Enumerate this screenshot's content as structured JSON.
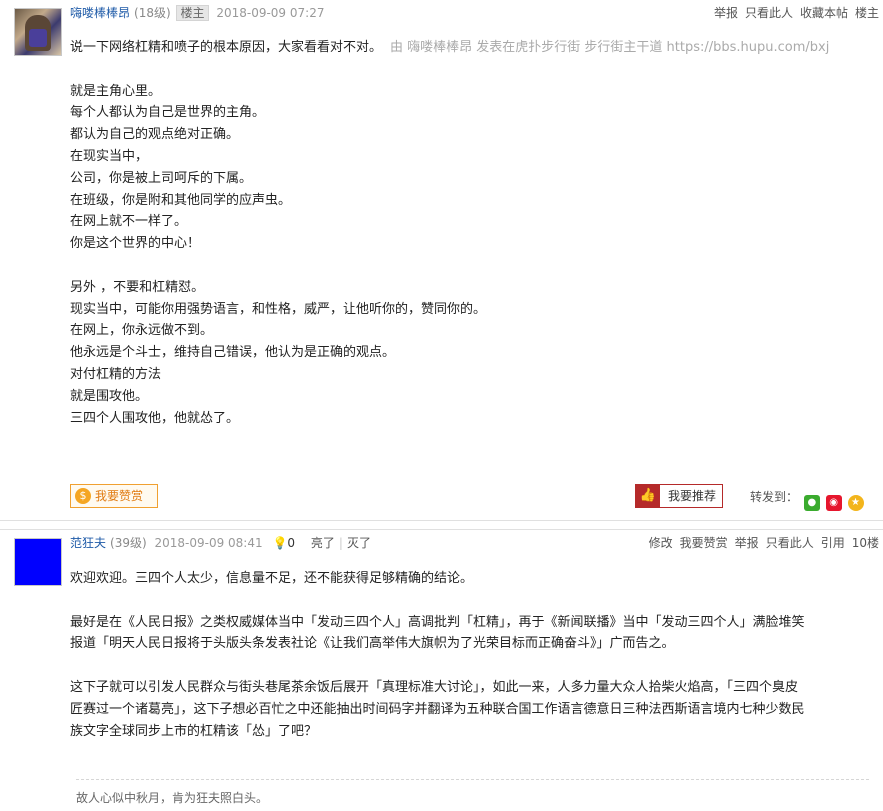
{
  "post1": {
    "username": "嗨喽棒棒昂",
    "level": "(18级)",
    "badge": "楼主",
    "time": "2018-09-09 07:27",
    "actions": [
      "举报",
      "只看此人",
      "收藏本帖",
      "楼主"
    ],
    "title_line": "说一下网络杠精和喷子的根本原因，大家看看对不对。",
    "source_line": "由  嗨喽棒棒昂 发表在虎扑步行街 步行街主干道 https://bbs.hupu.com/bxj",
    "paragraph1": [
      "就是主角心里。",
      "每个人都认为自己是世界的主角。",
      "都认为自己的观点绝对正确。",
      "在现实当中，",
      "公司，你是被上司呵斥的下属。",
      "在班级，你是附和其他同学的应声虫。",
      "在网上就不一样了。",
      "你是这个世界的中心！"
    ],
    "paragraph2": [
      "另外 ，不要和杠精怼。",
      "现实当中，可能你用强势语言，和性格，威严，让他听你的，赞同你的。",
      "在网上，你永远做不到。",
      "他永远是个斗士，维持自己错误，他认为是正确的观点。",
      "对付杠精的方法",
      "就是围攻他。",
      "三四个人围攻他，他就怂了。"
    ],
    "btn_zan": "我要赞赏",
    "btn_recommend": "我要推荐",
    "share_label": "转发到："
  },
  "post2": {
    "username": "范狂夫",
    "level": "(39级)",
    "time": "2018-09-09 08:41",
    "bulb_count": "0",
    "light": "亮了",
    "off": "灭了",
    "actions": [
      "修改",
      "我要赞赏",
      "举报",
      "只看此人",
      "引用",
      "10楼"
    ],
    "lines": [
      "欢迎欢迎。三四个人太少，信息量不足，还不能获得足够精确的结论。",
      "",
      "最好是在《人民日报》之类权威媒体当中「发动三四个人」高调批判「杠精」，再于《新闻联播》当中「发动三四个人」满脸堆笑",
      "报道「明天人民日报将于头版头条发表社论《让我们高举伟大旗帜为了光荣目标而正确奋斗》」广而告之。",
      "",
      "这下子就可以引发人民群众与街头巷尾茶余饭后展开「真理标准大讨论」，如此一来，人多力量大众人拾柴火焰高，「三四个臭皮",
      "匠赛过一个诸葛亮」，这下子想必百忙之中还能抽出时间码字并翻译为五种联合国工作语言德意日三种法西斯语言境内七种少数民",
      "族文字全球同步上市的杠精该「怂」了吧？"
    ],
    "signature": "故人心似中秋月，肯为狂夫照白头。"
  },
  "icons": [
    "coin-icon",
    "thumb-icon",
    "wechat-icon",
    "weibo-icon",
    "qzone-icon",
    "bulb-icon"
  ],
  "colors": {
    "link": "#1f5ba8",
    "zan": "#f0a030",
    "recommend": "#b52a2a",
    "avatar2": "#0000ff"
  }
}
